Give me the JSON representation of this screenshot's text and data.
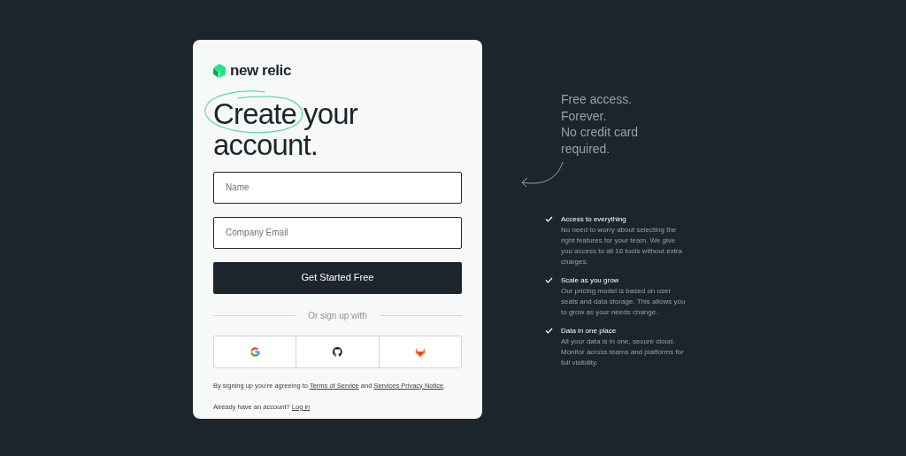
{
  "logo": {
    "text": "new relic"
  },
  "heading_lines": [
    [
      {
        "text": "Create",
        "circled": true
      },
      {
        "text": "your",
        "circled": false
      }
    ],
    [
      {
        "text": "account.",
        "circled": false
      }
    ]
  ],
  "fields": [
    {
      "placeholder": "Name"
    },
    {
      "placeholder": "Company Email"
    }
  ],
  "submit": "Get Started Free",
  "divider": "Or sign up with",
  "social": [
    {
      "kind": "google"
    },
    {
      "kind": "github"
    },
    {
      "kind": "gitlab"
    }
  ],
  "terms": [
    {
      "kind": "text",
      "text": "By signing up you're agreeing to"
    },
    {
      "kind": "link",
      "text": "Terms of Service"
    },
    {
      "kind": "text",
      "text": "and"
    },
    {
      "kind": "link",
      "text": "Services Privacy Notice"
    },
    {
      "kind": "text",
      "text": "."
    }
  ],
  "login": {
    "text": "Already have an account?",
    "link": "Log in"
  },
  "tagline": [
    "Free access.",
    "Forever.",
    "No credit card",
    "required."
  ],
  "features": [
    {
      "title": "Access to everything",
      "text": "No need to worry about selecting the right features for your team. We give you access to all 16 tools without extra charges."
    },
    {
      "title": "Scale as you grow",
      "text": "Our pricing model is based on user seats and data storage. This allows you to grow as your needs change."
    },
    {
      "title": "Data in one place",
      "text": "All your data is in one, secure cloud. Monitor across teams and platforms for full visibility."
    }
  ]
}
